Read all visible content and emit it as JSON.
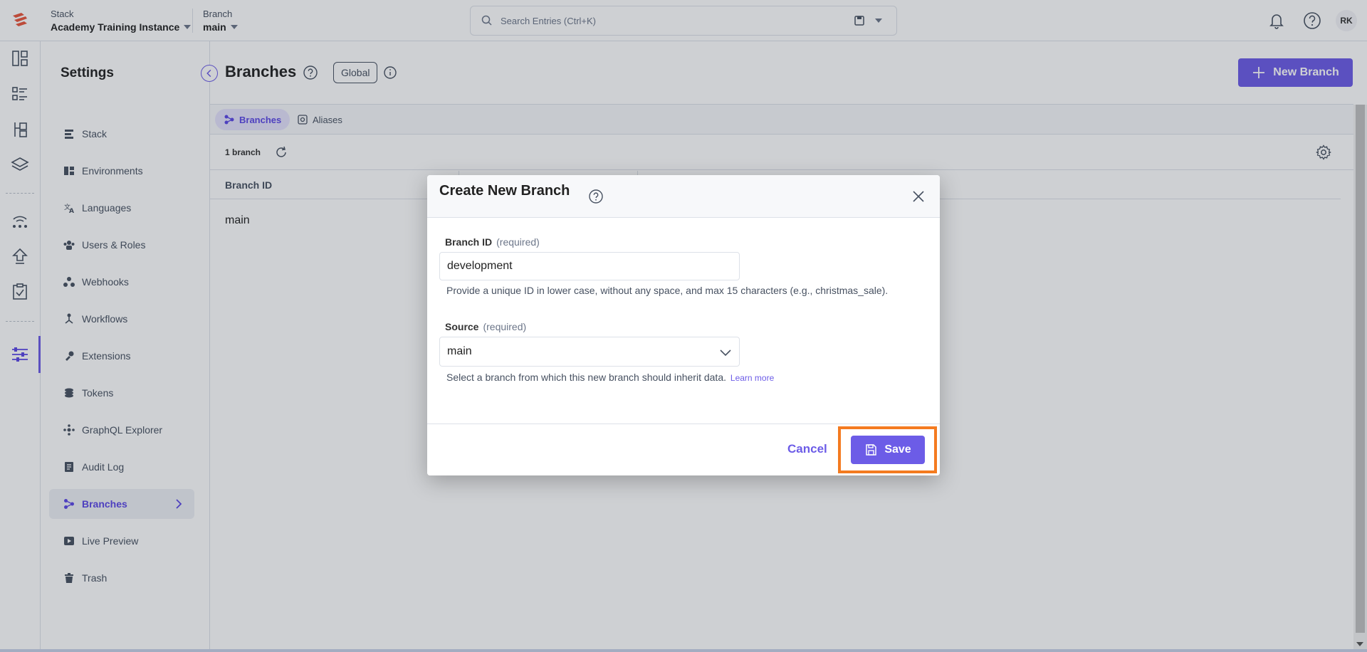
{
  "topbar": {
    "stack_label": "Stack",
    "stack_name": "Academy Training Instance",
    "branch_label": "Branch",
    "branch_name": "main",
    "search_placeholder": "Search Entries (Ctrl+K)",
    "avatar_initials": "RK"
  },
  "rail": {
    "icons": [
      "dashboard-icon",
      "entries-list-icon",
      "content-models-icon",
      "assets-layers-icon",
      "releases-icon",
      "deploy-icon",
      "tasks-icon",
      "settings-sliders-icon"
    ]
  },
  "settings": {
    "title": "Settings",
    "items": [
      {
        "label": "Stack",
        "icon": "stack-icon"
      },
      {
        "label": "Environments",
        "icon": "environments-icon"
      },
      {
        "label": "Languages",
        "icon": "languages-icon"
      },
      {
        "label": "Users & Roles",
        "icon": "users-icon"
      },
      {
        "label": "Webhooks",
        "icon": "webhooks-icon"
      },
      {
        "label": "Workflows",
        "icon": "workflows-icon"
      },
      {
        "label": "Extensions",
        "icon": "extensions-icon"
      },
      {
        "label": "Tokens",
        "icon": "tokens-icon"
      },
      {
        "label": "GraphQL Explorer",
        "icon": "graphql-icon"
      },
      {
        "label": "Audit Log",
        "icon": "audit-log-icon"
      },
      {
        "label": "Branches",
        "icon": "branches-icon",
        "active": true
      },
      {
        "label": "Live Preview",
        "icon": "live-preview-icon"
      },
      {
        "label": "Trash",
        "icon": "trash-icon"
      }
    ]
  },
  "main": {
    "title": "Branches",
    "global_badge": "Global",
    "new_button": "New Branch",
    "tabs": [
      {
        "label": "Branches",
        "active": true
      },
      {
        "label": "Aliases",
        "active": false
      }
    ],
    "count": "1 branch",
    "column_header": "Branch ID",
    "rows": [
      {
        "branch_id": "main"
      }
    ]
  },
  "modal": {
    "title": "Create New Branch",
    "branch_id_label": "Branch ID",
    "required": "(required)",
    "branch_id_value": "development",
    "branch_id_hint": "Provide a unique ID in lower case, without any space, and max 15 characters (e.g., christmas_sale).",
    "source_label": "Source",
    "source_value": "main",
    "source_hint": "Select a branch from which this new branch should inherit data.",
    "learn_more": "Learn more",
    "cancel": "Cancel",
    "save": "Save"
  },
  "colors": {
    "accent": "#6c5ce7",
    "highlight": "#f47b20",
    "brand_logo": "#e8553c"
  }
}
